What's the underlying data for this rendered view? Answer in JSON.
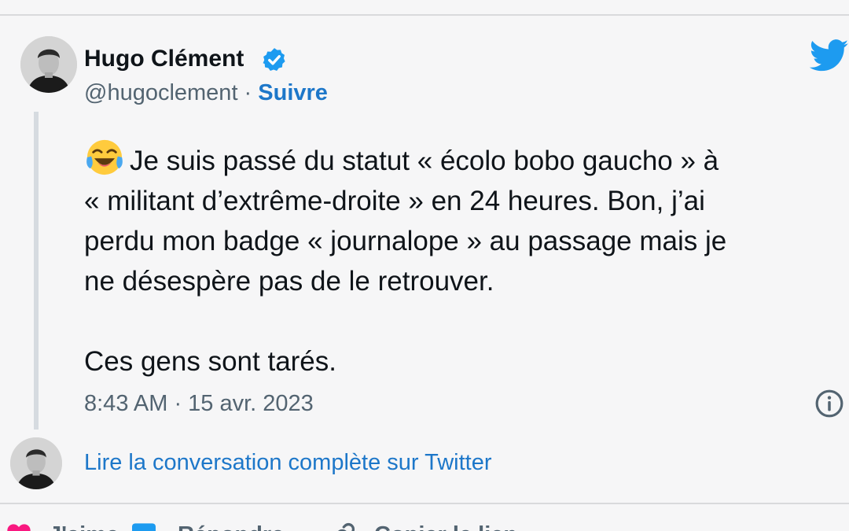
{
  "tweet": {
    "author": {
      "name": "Hugo Clément",
      "handle": "@hugoclement",
      "separator": " · ",
      "follow_label": "Suivre",
      "verified": true
    },
    "lines": [
      "Je suis passé du statut « écolo bobo gaucho » à",
      "« militant d’extrême-droite » en 24 heures. Bon, j’ai",
      "perdu mon badge « journalope » au passage mais je",
      "ne désespère pas de le retrouver."
    ],
    "closing_line": "Ces gens sont tarés.",
    "emoji": "face-with-tears-of-joy",
    "timestamp": "8:43 AM · 15 avr. 2023"
  },
  "conversation_link": "Lire la conversation complète sur Twitter",
  "actions": [
    {
      "label": "J'aime",
      "icon": "heart-icon"
    },
    {
      "label": "Répondre",
      "icon": "reply-icon"
    },
    {
      "label": "Copier le lien",
      "icon": "link-icon"
    }
  ],
  "colors": {
    "background": "#f6f6f7",
    "text": "#0f1419",
    "secondary": "#536471",
    "link": "#1d77c9",
    "twitter_blue": "#1d9bf0",
    "heart": "#f91880"
  }
}
